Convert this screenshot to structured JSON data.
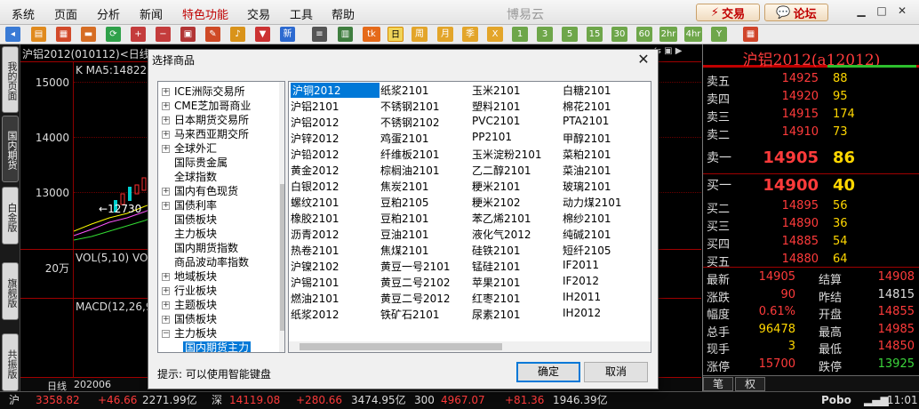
{
  "menu": {
    "items": [
      "系统",
      "页面",
      "分析",
      "新闻",
      "特色功能",
      "交易",
      "工具",
      "帮助"
    ],
    "brand": "博易云",
    "trade_btn": "交易",
    "forum_btn": "论坛"
  },
  "toolbar": {
    "periods": [
      "日",
      "周",
      "月",
      "季",
      "X",
      "1",
      "3",
      "5",
      "15",
      "30",
      "60",
      "2hr",
      "4hr",
      "Y"
    ]
  },
  "left_tabs": [
    "我的页面",
    "国内期货",
    "白金版",
    "旗舰版",
    "共振版"
  ],
  "chart": {
    "title": "沪铝2012(010112)<日线>",
    "ma5": "K  MA5:14822",
    "yticks": [
      "15000",
      "14000",
      "13000",
      "20万"
    ],
    "low_label": "12730",
    "vol": "VOL(5,10) VO",
    "macd": "MACD(12,26,9",
    "footer": {
      "period": "日线",
      "date": "202006"
    }
  },
  "quote": {
    "title": "沪铝2012(a12012)",
    "asks": [
      {
        "label": "卖五",
        "price": "14925",
        "vol": "88"
      },
      {
        "label": "卖四",
        "price": "14920",
        "vol": "95"
      },
      {
        "label": "卖三",
        "price": "14915",
        "vol": "174"
      },
      {
        "label": "卖二",
        "price": "14910",
        "vol": "73"
      },
      {
        "label": "卖一",
        "price": "14905",
        "vol": "86"
      }
    ],
    "bids": [
      {
        "label": "买一",
        "price": "14900",
        "vol": "40"
      },
      {
        "label": "买二",
        "price": "14895",
        "vol": "56"
      },
      {
        "label": "买三",
        "price": "14890",
        "vol": "36"
      },
      {
        "label": "买四",
        "price": "14885",
        "vol": "54"
      },
      {
        "label": "买五",
        "price": "14880",
        "vol": "64"
      }
    ],
    "stats": [
      {
        "l1": "最新",
        "v1": "14905",
        "l2": "结算",
        "v2": "14908"
      },
      {
        "l1": "涨跌",
        "v1": "90",
        "l2": "昨结",
        "v2": "14815"
      },
      {
        "l1": "幅度",
        "v1": "0.61%",
        "l2": "开盘",
        "v2": "14855"
      },
      {
        "l1": "总手",
        "v1": "96478",
        "l2": "最高",
        "v2": "14985"
      },
      {
        "l1": "现手",
        "v1": "3",
        "l2": "最低",
        "v2": "14850"
      },
      {
        "l1": "涨停",
        "v1": "15700",
        "l2": "跌停",
        "v2": "13925"
      }
    ],
    "tabs": [
      "笔",
      "权"
    ]
  },
  "status": {
    "sh_label": "沪",
    "sh_index": "3358.82",
    "sh_change": "+46.66",
    "sh_amount": "2271.99亿",
    "sz_label": "深",
    "sz_index": "14119.08",
    "sz_change": "+280.66",
    "sz_amount": "3474.95亿",
    "hs_label": "300",
    "hs_index": "4967.07",
    "hs_change": "+81.36",
    "hs_amount": "1946.39亿",
    "brand": "Pobo",
    "time": "11:01"
  },
  "dialog": {
    "title": "选择商品",
    "close": "✕",
    "hint": "提示: 可以使用智能键盘",
    "ok": "确定",
    "cancel": "取消",
    "tree": [
      "ICE洲际交易所",
      "CME芝加哥商业",
      "日本期货交易所",
      "马来西亚期交所",
      "全球外汇",
      "国际贵金属",
      "全球指数",
      "国内有色现货",
      "国债利率",
      "国债板块",
      "主力板块",
      "国内期货指数",
      "商品波动率指数",
      "地域板块",
      "行业板块",
      "主题板块",
      "国债板块",
      "主力板块",
      "国内期货主力"
    ],
    "columns": [
      [
        "沪铜2012",
        "沪铝2101",
        "沪铝2012",
        "沪锌2012",
        "沪铅2012",
        "黄金2012",
        "白银2012",
        "螺纹2101",
        "橡胶2101",
        "沥青2012",
        "热卷2101",
        "沪镍2102",
        "沪锡2101",
        "燃油2101",
        "纸浆2012"
      ],
      [
        "纸浆2101",
        "不锈钢2101",
        "不锈钢2102",
        "鸡蛋2101",
        "纤维板2101",
        "棕榈油2101",
        "焦炭2101",
        "豆粕2105",
        "豆粕2101",
        "豆油2101",
        "焦煤2101",
        "黄豆一号2101",
        "黄豆二号2102",
        "黄豆二号2012",
        "铁矿石2101"
      ],
      [
        "玉米2101",
        "塑料2101",
        "PVC2101",
        "PP2101",
        "玉米淀粉2101",
        "乙二醇2101",
        "粳米2101",
        "粳米2102",
        "苯乙烯2101",
        "液化气2012",
        "硅铁2101",
        "锰硅2101",
        "苹果2101",
        "红枣2101",
        "尿素2101"
      ],
      [
        "白糖2101",
        "棉花2101",
        "PTA2101",
        "甲醇2101",
        "菜粕2101",
        "菜油2101",
        "玻璃2101",
        "动力煤2101",
        "棉纱2101",
        "纯碱2101",
        "短纤2105",
        "IF2011",
        "IF2012",
        "IH2011",
        "IH2012"
      ]
    ]
  }
}
